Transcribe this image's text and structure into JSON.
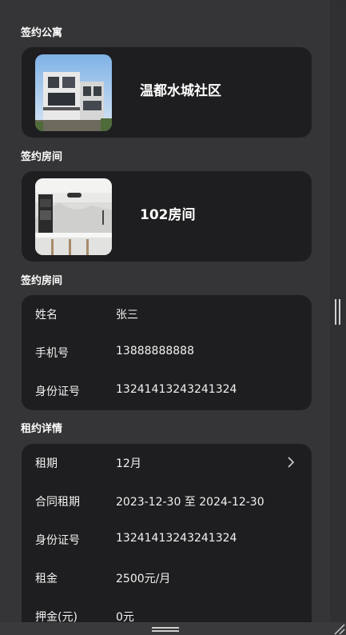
{
  "apartment": {
    "section_title": "签约公寓",
    "name": "温都水城社区",
    "image_icon": "building-photo"
  },
  "room": {
    "section_title": "签约房间",
    "name": "102房间",
    "image_icon": "kitchen-photo"
  },
  "tenant": {
    "section_title": "签约房间",
    "rows": [
      {
        "label": "姓名",
        "value": "张三"
      },
      {
        "label": "手机号",
        "value": "13888888888"
      },
      {
        "label": "身份证号",
        "value": "13241413243241324"
      }
    ]
  },
  "lease": {
    "section_title": "租约详情",
    "rows": [
      {
        "label": "租期",
        "value": "12月"
      },
      {
        "label": "合同租期",
        "value": "2023-12-30 至 2024-12-30"
      },
      {
        "label": "身份证号",
        "value": "13241413243241324"
      },
      {
        "label": "租金",
        "value": "2500元/月"
      },
      {
        "label": "押金(元)",
        "value": "0元"
      }
    ]
  },
  "colors": {
    "background": "#353537",
    "card": "#1e1e20",
    "text": "#ffffff"
  }
}
